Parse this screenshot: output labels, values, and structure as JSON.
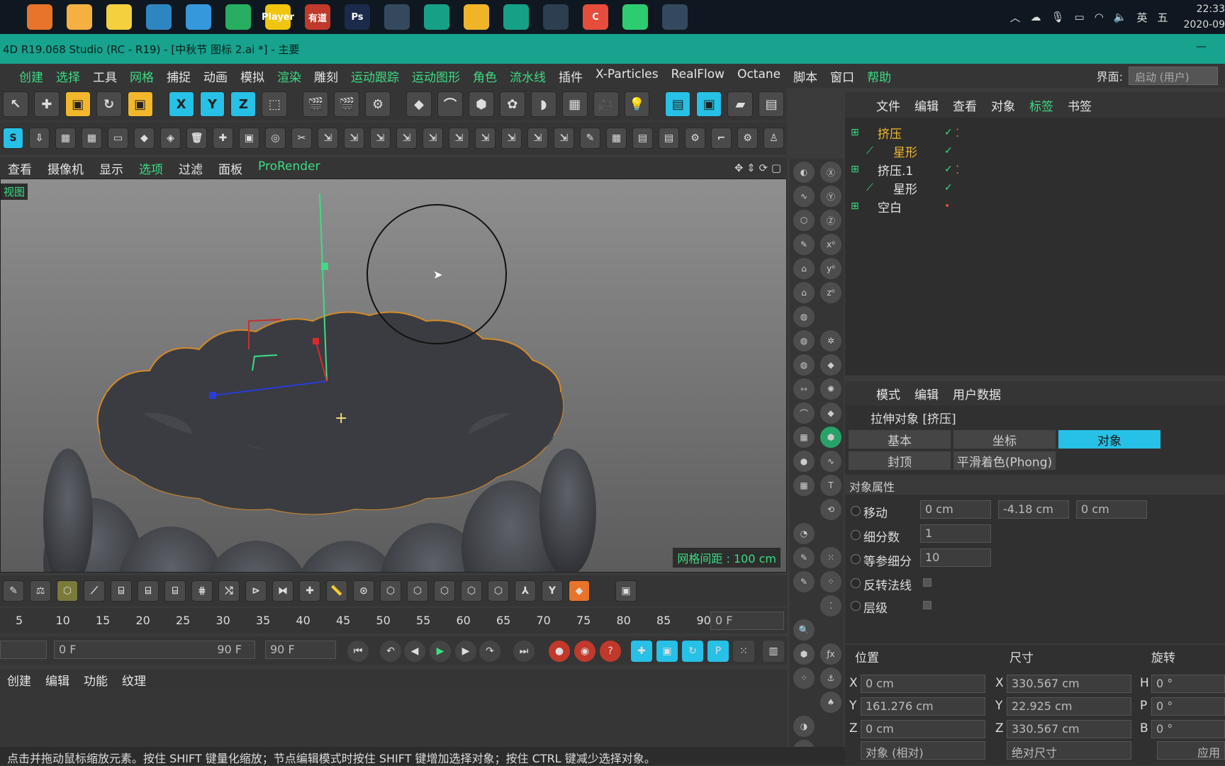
{
  "taskbar": {
    "apps": [
      {
        "icon": "sublime-icon",
        "color": "#e8732a"
      },
      {
        "icon": "user-icon",
        "color": "#f5b041"
      },
      {
        "icon": "notes-icon",
        "color": "#f4d03f"
      },
      {
        "icon": "edge-icon",
        "color": "#2e86c1"
      },
      {
        "icon": "q-browser-icon",
        "color": "#3498db"
      },
      {
        "icon": "chrome-icon",
        "color": "#27ae60"
      },
      {
        "icon": "player-icon",
        "color": "#f1c40f",
        "text": "Player"
      },
      {
        "icon": "youdao-icon",
        "color": "#c0392b",
        "text": "有道"
      },
      {
        "icon": "photoshop-icon",
        "color": "#1b2a4a",
        "text": "Ps"
      },
      {
        "icon": "cinema4d-icon",
        "color": "#34495e"
      },
      {
        "icon": "earth-icon",
        "color": "#16a085"
      },
      {
        "icon": "folder-icon",
        "color": "#f0b429"
      },
      {
        "icon": "windows-store-icon",
        "color": "#16a085"
      },
      {
        "icon": "pen-tool-icon",
        "color": "#2c3e50"
      },
      {
        "icon": "c-app-icon",
        "color": "#e74c3c",
        "text": "C"
      },
      {
        "icon": "wechat-icon",
        "color": "#2ecc71"
      },
      {
        "icon": "cinema4d-2-icon",
        "color": "#34495e"
      }
    ],
    "tray": {
      "lang": "英",
      "ime": "五",
      "time": "22:33",
      "date": "2020-09"
    }
  },
  "window": {
    "title": "4D R19.068 Studio (RC - R19) - [中秋节 图标 2.ai *] - 主要"
  },
  "menu": [
    {
      "label": "创建",
      "green": true
    },
    {
      "label": "选择",
      "green": true
    },
    {
      "label": "工具",
      "green": false
    },
    {
      "label": "网格",
      "green": true
    },
    {
      "label": "捕捉",
      "green": false
    },
    {
      "label": "动画",
      "green": false
    },
    {
      "label": "模拟",
      "green": false
    },
    {
      "label": "渲染",
      "green": true
    },
    {
      "label": "雕刻",
      "green": false
    },
    {
      "label": "运动跟踪",
      "green": true
    },
    {
      "label": "运动图形",
      "green": true
    },
    {
      "label": "角色",
      "green": true
    },
    {
      "label": "流水线",
      "green": true
    },
    {
      "label": "插件",
      "green": false
    },
    {
      "label": "X-Particles",
      "green": false
    },
    {
      "label": "RealFlow",
      "green": false
    },
    {
      "label": "Octane",
      "green": false
    },
    {
      "label": "脚本",
      "green": false
    },
    {
      "label": "窗口",
      "green": false
    },
    {
      "label": "帮助",
      "green": true
    }
  ],
  "layout": {
    "label": "界面:",
    "value": "启动 (用户)"
  },
  "toolbar1": [
    {
      "icon": "select-cursor-icon",
      "text": "↖",
      "style": ""
    },
    {
      "icon": "move-icon",
      "text": "✚",
      "style": ""
    },
    {
      "icon": "scale-icon",
      "text": "▣",
      "style": "yl"
    },
    {
      "icon": "rotate-icon",
      "text": "↻",
      "style": ""
    },
    {
      "icon": "scale-box-icon",
      "text": "▣",
      "style": "yl"
    },
    {
      "icon": "x-axis-icon",
      "text": "X",
      "style": "cy"
    },
    {
      "icon": "y-axis-icon",
      "text": "Y",
      "style": "cy"
    },
    {
      "icon": "z-axis-icon",
      "text": "Z",
      "style": "cy"
    },
    {
      "icon": "coordinate-system-icon",
      "text": "⬚",
      "style": ""
    },
    {
      "icon": "render-view-icon",
      "text": "🎬",
      "style": ""
    },
    {
      "icon": "render-picture-icon",
      "text": "🎬",
      "style": ""
    },
    {
      "icon": "render-settings-icon",
      "text": "⚙",
      "style": ""
    },
    {
      "icon": "cube-icon",
      "text": "◆",
      "style": ""
    },
    {
      "icon": "spline-pen-icon",
      "text": "⌒",
      "style": ""
    },
    {
      "icon": "subdivision-icon",
      "text": "⬢",
      "style": ""
    },
    {
      "icon": "array-icon",
      "text": "✿",
      "style": ""
    },
    {
      "icon": "deformer-icon",
      "text": "◗",
      "style": ""
    },
    {
      "icon": "floor-icon",
      "text": "▦",
      "style": ""
    },
    {
      "icon": "camera-icon",
      "text": "🎥",
      "style": ""
    },
    {
      "icon": "light-icon",
      "text": "💡",
      "style": ""
    },
    {
      "icon": "layout-icon",
      "text": "▤",
      "style": "cy"
    },
    {
      "icon": "viewport-icon",
      "text": "▣",
      "style": "cy"
    },
    {
      "icon": "folder-icon",
      "text": "▰",
      "style": ""
    },
    {
      "icon": "document-icon",
      "text": "▤",
      "style": ""
    }
  ],
  "toolbar2": [
    "s-icon",
    "export-icon",
    "clapper-icon",
    "clapper-2-icon",
    "monitor-icon",
    "cube-gray-icon",
    "cubes-icon",
    "trash-icon",
    "add-point-icon",
    "box-select-icon",
    "loop-icon",
    "knife-icon",
    "snap-icon",
    "snap-2-icon",
    "snap-3-icon",
    "snap-4-icon",
    "snap-5-icon",
    "snap-6-icon",
    "snap-7-icon",
    "snap-8-icon",
    "snap-9-icon",
    "snap-10-icon",
    "pen-icon",
    "grid-snap-icon",
    "stack-icon",
    "stack-2-icon",
    "gear-gray-icon",
    "corner-icon",
    "settings-icon",
    "character-icon"
  ],
  "viewport": {
    "menu": [
      "查看",
      "摄像机",
      "显示",
      "选项",
      "过滤",
      "面板",
      "ProRender"
    ],
    "menu_green": [
      false,
      false,
      false,
      true,
      false,
      false,
      true
    ],
    "tag": "视图",
    "grid": "网格间距 : 100 cm"
  },
  "object_manager": {
    "menu": [
      "文件",
      "编辑",
      "查看",
      "对象",
      "标签",
      "书签"
    ],
    "menu_green": [
      false,
      false,
      false,
      false,
      true,
      false
    ],
    "rows": [
      {
        "name": "挤压",
        "indent": 0,
        "color": "#f3b72c"
      },
      {
        "name": "星形",
        "indent": 1,
        "color": "#f3b72c"
      },
      {
        "name": "挤压.1",
        "indent": 0,
        "color": "#e6e6e6"
      },
      {
        "name": "星形",
        "indent": 1,
        "color": "#e6e6e6"
      },
      {
        "name": "空白",
        "indent": 0,
        "color": "#e6e6e6"
      }
    ]
  },
  "attributes": {
    "menu": [
      "模式",
      "编辑",
      "用户数据"
    ],
    "title": "拉伸对象 [挤压]",
    "tabs": [
      "基本",
      "坐标",
      "对象",
      "封顶",
      "平滑着色(Phong)"
    ],
    "section": "对象属性",
    "move_label": "移动",
    "move": [
      "0 cm",
      "-4.18 cm",
      "0 cm"
    ],
    "subdiv_label": "细分数",
    "subdiv": "1",
    "iso_label": "等参细分",
    "iso": "10",
    "flip_label": "反转法线",
    "hier_label": "层级"
  },
  "coordinates": {
    "headers": [
      "位置",
      "尺寸",
      "旋转"
    ],
    "pos": [
      {
        "axis": "X",
        "val": "0 cm"
      },
      {
        "axis": "Y",
        "val": "161.276 cm"
      },
      {
        "axis": "Z",
        "val": "0 cm"
      }
    ],
    "size": [
      {
        "axis": "X",
        "val": "330.567 cm"
      },
      {
        "axis": "Y",
        "val": "22.925 cm"
      },
      {
        "axis": "Z",
        "val": "330.567 cm"
      }
    ],
    "rot": [
      {
        "axis": "H",
        "val": "0 °"
      },
      {
        "axis": "P",
        "val": "0 °"
      },
      {
        "axis": "B",
        "val": "0 °"
      }
    ],
    "mode1": "对象 (相对)",
    "mode2": "绝对尺寸",
    "apply": "应用"
  },
  "timeline": {
    "ticks": [
      "5",
      "10",
      "15",
      "20",
      "25",
      "30",
      "35",
      "40",
      "45",
      "50",
      "55",
      "60",
      "65",
      "70",
      "75",
      "80",
      "85",
      "90"
    ],
    "current": "0 F",
    "start": "0 F",
    "end": "90 F",
    "end2": "90 F"
  },
  "material": {
    "menu": [
      "创建",
      "编辑",
      "功能",
      "纹理"
    ]
  },
  "status": "点击并拖动鼠标缩放元素。按住 SHIFT 键量化缩放；节点编辑模式时按住 SHIFT 键增加选择对象；按住 CTRL 键减少选择对象。"
}
